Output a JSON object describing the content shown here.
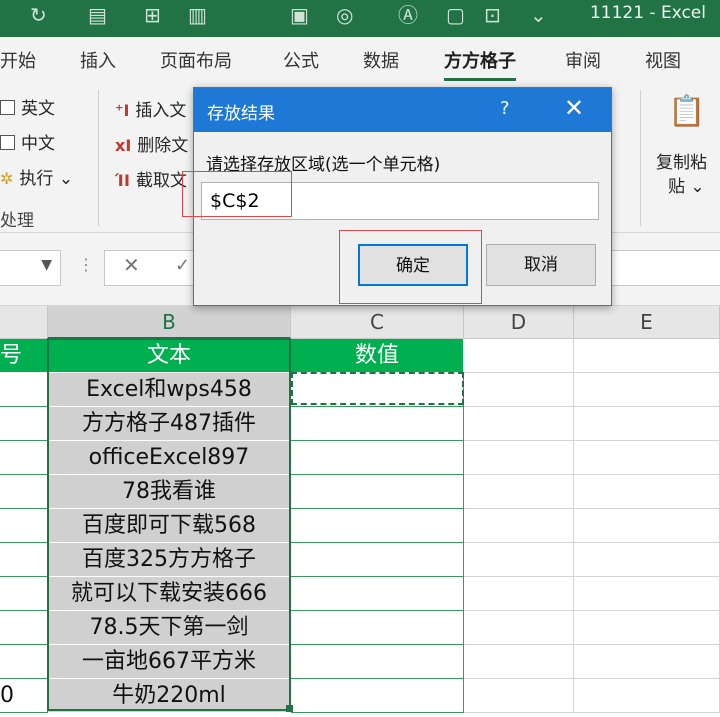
{
  "window": {
    "title": "11121  -  Excel"
  },
  "tabs": [
    "开始",
    "插入",
    "页面布局",
    "公式",
    "数据",
    "方方格子",
    "审阅",
    "视图"
  ],
  "active_tab": "方方格子",
  "ribbon": {
    "opt_english": "英文",
    "opt_chinese": "中文",
    "execute": "执行",
    "group_label": "处理",
    "insert_text": "插入文",
    "delete_text": "删除文",
    "extract_text": "截取文",
    "copy_paste_line1": "复制粘",
    "copy_paste_line2": "贴"
  },
  "dialog": {
    "title": "存放结果",
    "help": "?",
    "close": "✕",
    "prompt": "请选择存放区域(选一个单元格)",
    "value": "$C$2",
    "ok": "确定",
    "cancel": "取消"
  },
  "grid": {
    "column_headers": [
      "B",
      "C",
      "D",
      "E"
    ],
    "header_row": {
      "a": "号",
      "b": "文本",
      "c": "数值"
    },
    "rows": [
      {
        "a": "",
        "b": "Excel和wps458"
      },
      {
        "a": "",
        "b": "方方格子487插件"
      },
      {
        "a": "",
        "b": "officeExcel897"
      },
      {
        "a": "",
        "b": "78我看谁"
      },
      {
        "a": "",
        "b": "百度即可下载568"
      },
      {
        "a": "",
        "b": "百度325方方格子"
      },
      {
        "a": "",
        "b": "就可以下载安装666"
      },
      {
        "a": "",
        "b": "78.5天下第一剑"
      },
      {
        "a": "",
        "b": "一亩地667平方米"
      },
      {
        "a": "0",
        "b": "牛奶220ml"
      }
    ]
  },
  "colors": {
    "excel_green": "#217346",
    "header_green": "#00b050",
    "dialog_blue": "#1e79d6",
    "highlight_red": "#e04848"
  }
}
